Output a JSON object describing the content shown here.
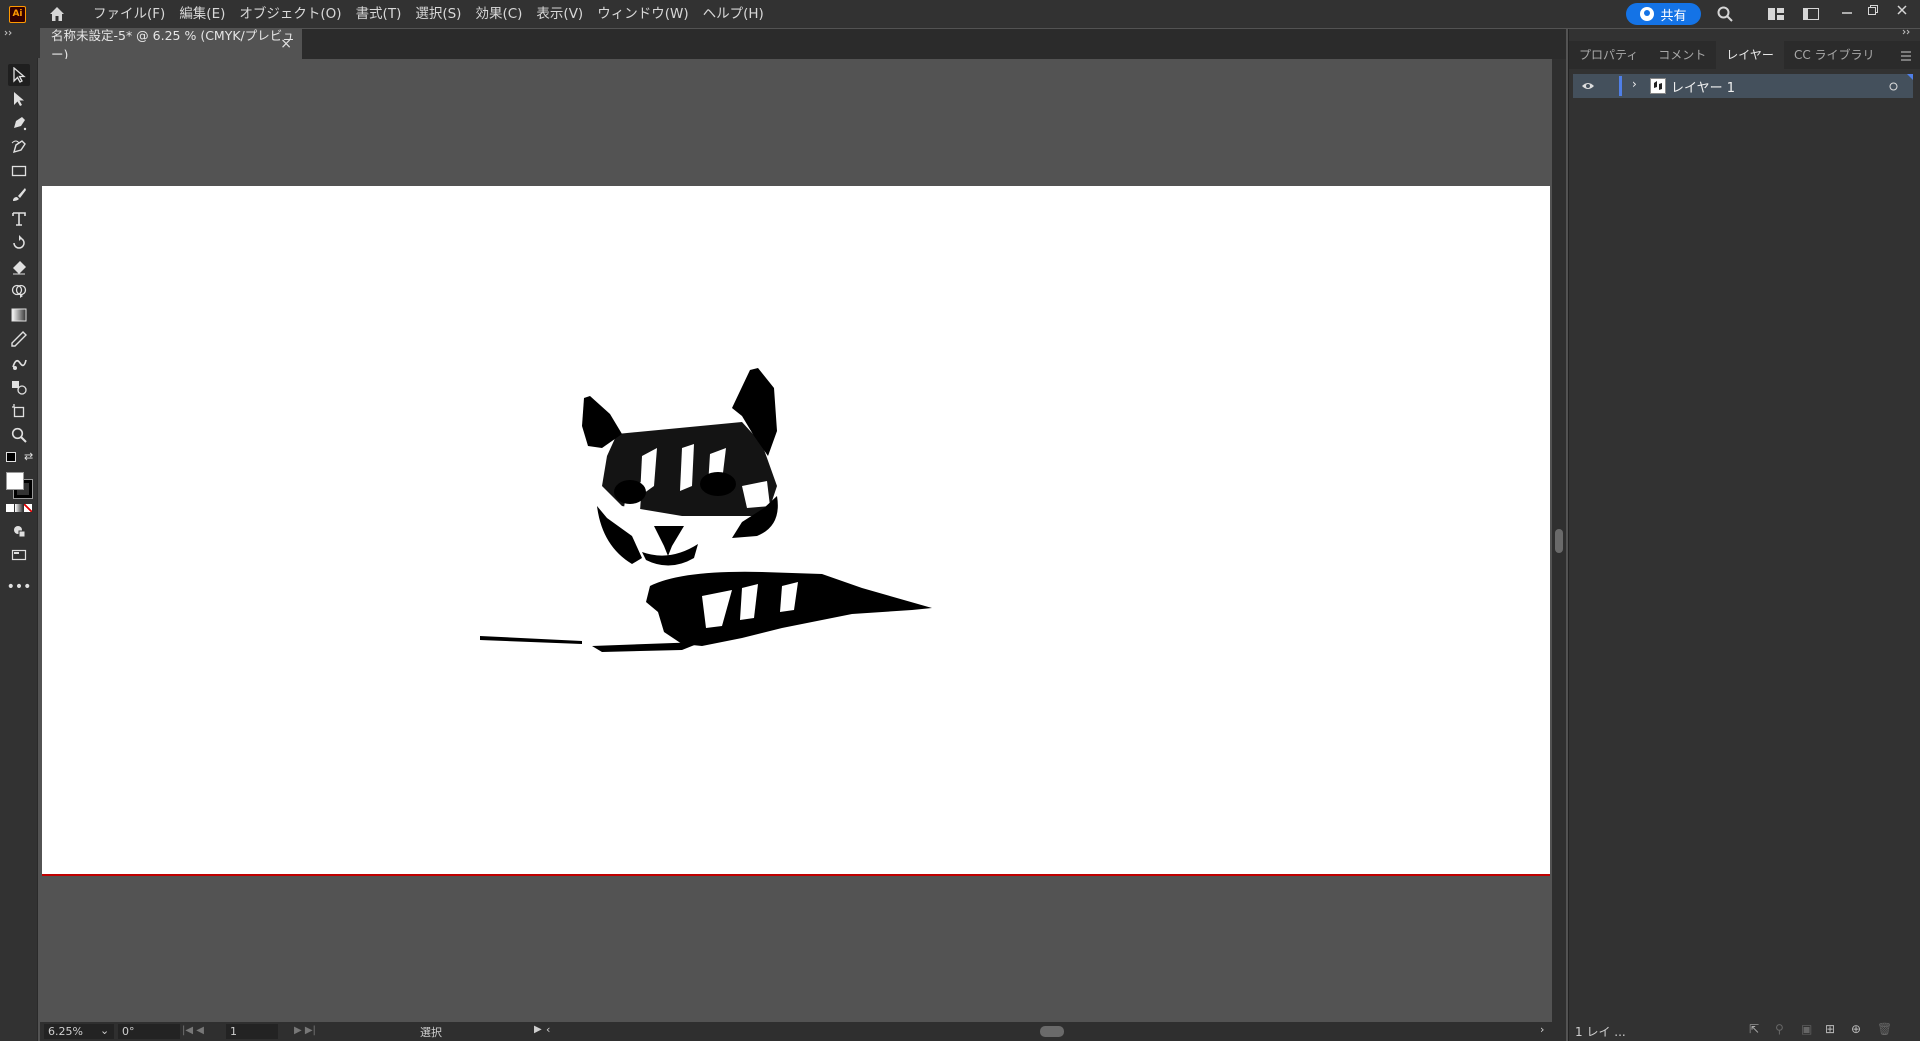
{
  "app": {
    "logo": "Ai",
    "title": "Adobe Illustrator"
  },
  "menu": [
    "ファイル(F)",
    "編集(E)",
    "オブジェクト(O)",
    "書式(T)",
    "選択(S)",
    "効果(C)",
    "表示(V)",
    "ウィンドウ(W)",
    "ヘルプ(H)"
  ],
  "share": {
    "label": "共有"
  },
  "document_tab": {
    "title": "名称未設定-5* @ 6.25 % (CMYK/プレビュー)",
    "close": "×"
  },
  "tools": [
    "selection-tool",
    "direct-selection-tool",
    "pen-tool",
    "curvature-tool",
    "rectangle-tool",
    "paintbrush-tool",
    "type-tool",
    "rotate-tool",
    "eraser-tool",
    "shape-builder-tool",
    "gradient-tool",
    "eyedropper-tool",
    "puppet-warp-tool",
    "blend-tool",
    "artboard-tool",
    "zoom-tool"
  ],
  "panel": {
    "tabs": [
      "プロパティ",
      "コメント",
      "レイヤー",
      "CC ライブラリ"
    ],
    "active_tab": "レイヤー",
    "layers": [
      {
        "name": "レイヤー 1",
        "visible": true
      }
    ],
    "footer_text": "1 レイ ..."
  },
  "status": {
    "zoom": "6.25%",
    "rotation": "0°",
    "artboard": "1",
    "tool": "選択"
  },
  "colors": {
    "accent": "#1473e6",
    "layer_color": "#4f7fe8",
    "artboard_edge": "#c00000"
  }
}
